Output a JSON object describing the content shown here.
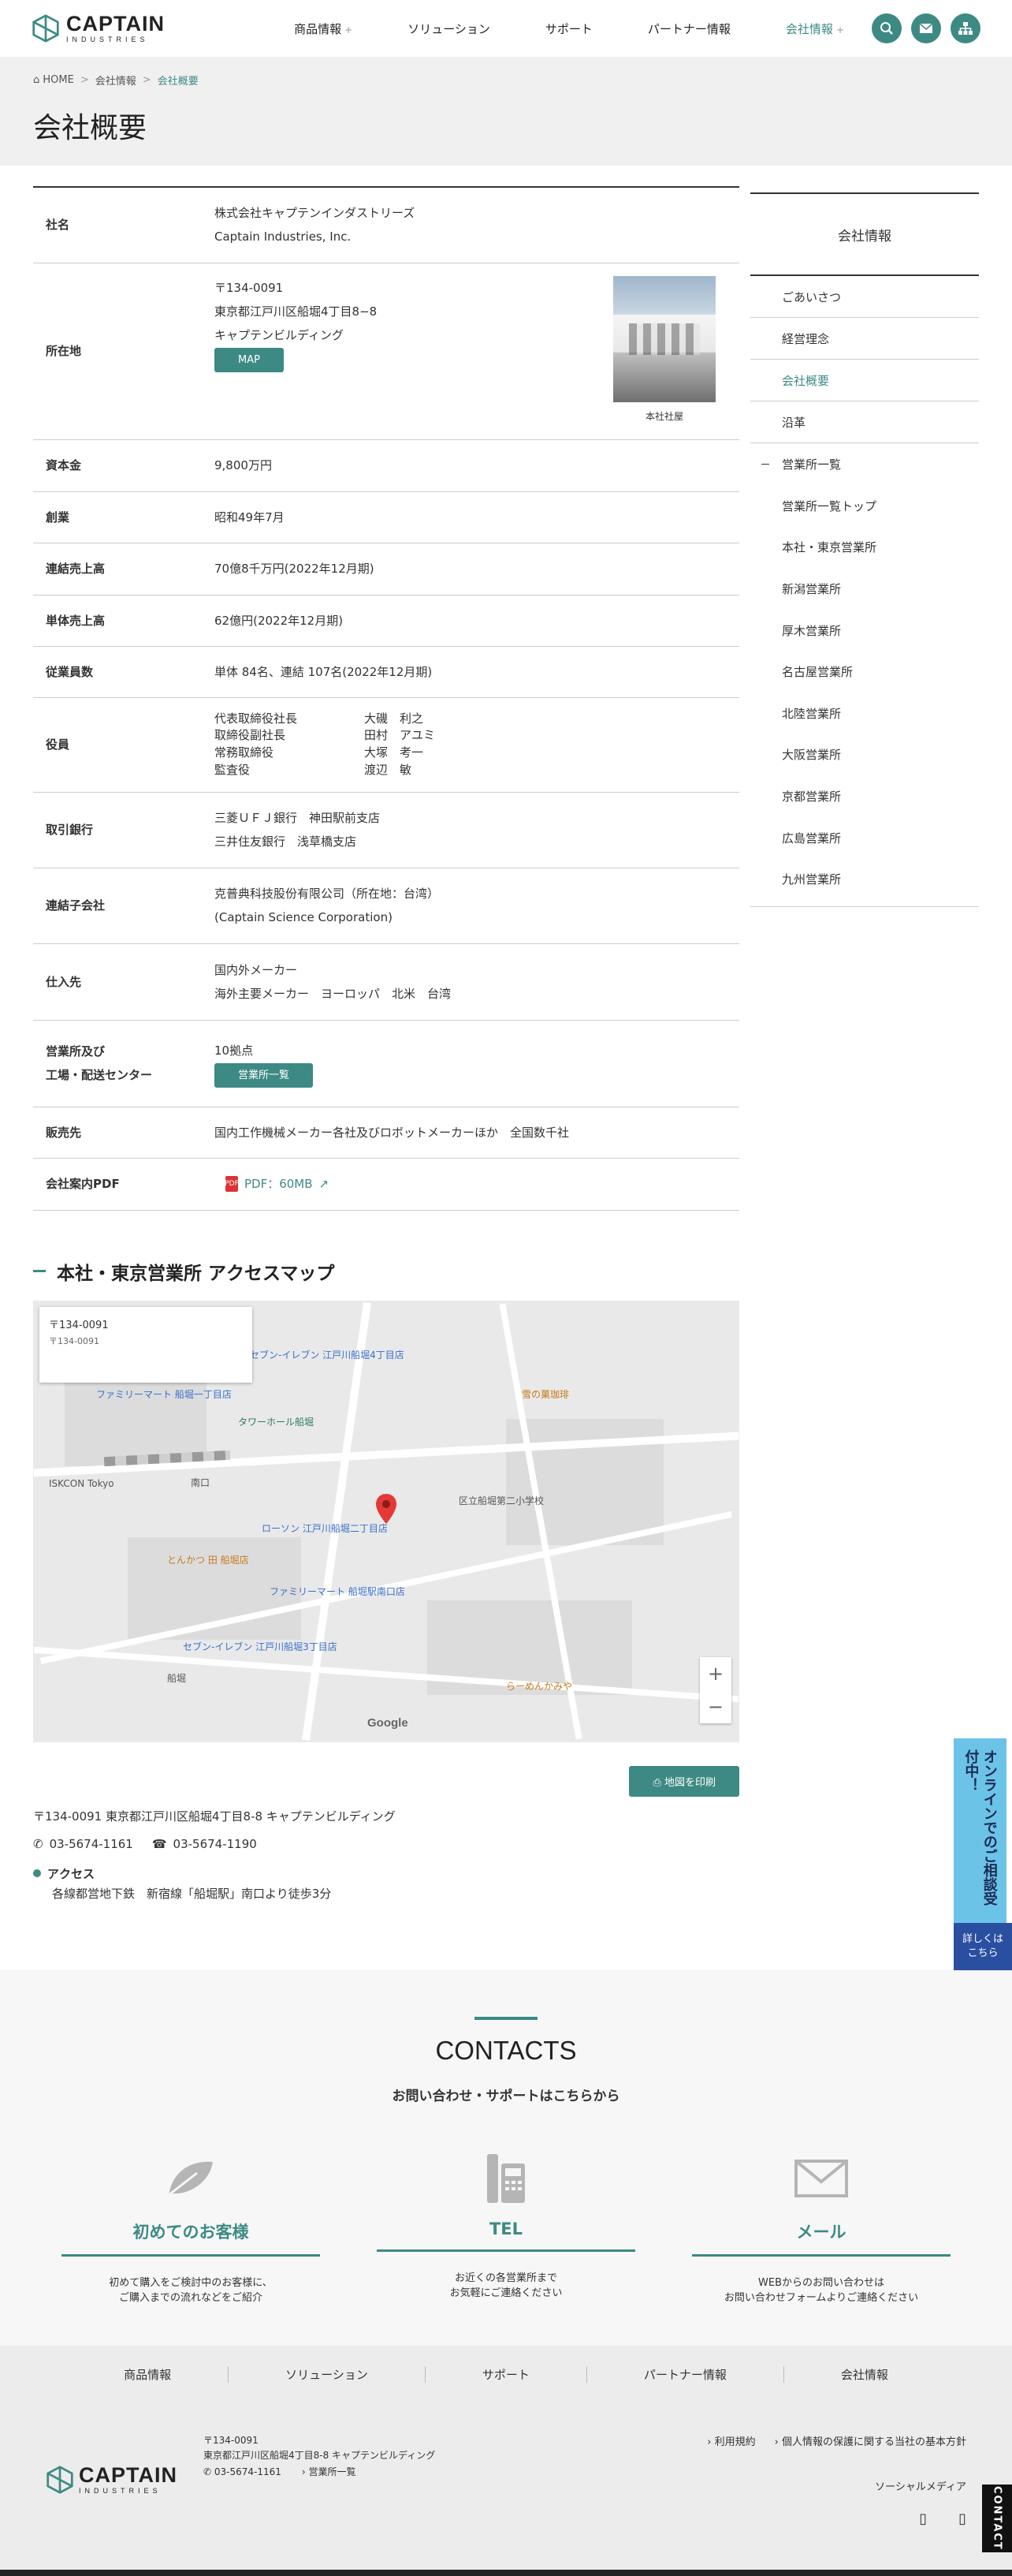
{
  "header": {
    "logo_main": "CAPTAIN",
    "logo_sub": "INDUSTRIES",
    "nav": [
      {
        "label": "商品情報",
        "plus": "+"
      },
      {
        "label": "ソリューション",
        "plus": ""
      },
      {
        "label": "サポート",
        "plus": ""
      },
      {
        "label": "パートナー情報",
        "plus": ""
      },
      {
        "label": "会社情報",
        "plus": "+"
      }
    ]
  },
  "breadcrumb": {
    "home": "HOME",
    "parent": "会社情報",
    "current": "会社概要",
    "sep": ">"
  },
  "page_title": "会社概要",
  "table": {
    "name_label": "社名",
    "name_values": [
      "株式会社キャプテンインダストリーズ",
      "Captain Industries, Inc."
    ],
    "address_label": "所在地",
    "address_values": [
      "〒134-0091",
      "東京都江戸川区船堀4丁目8−8",
      "キャプテンビルディング"
    ],
    "map_button": "MAP",
    "building_caption": "本社社屋",
    "capital_label": "資本金",
    "capital_value": "9,800万円",
    "founded_label": "創業",
    "founded_value": "昭和49年7月",
    "consolidated_label": "連結売上高",
    "consolidated_value": "70億8千万円(2022年12月期)",
    "standalone_label": "単体売上高",
    "standalone_value": "62億円(2022年12月期)",
    "employees_label": "従業員数",
    "employees_value": "単体 84名、連結 107名(2022年12月期)",
    "officers_label": "役員",
    "officers": [
      {
        "title": "代表取締役社長",
        "name": "大磯　利之"
      },
      {
        "title": "取締役副社長",
        "name": "田村　アユミ"
      },
      {
        "title": "常務取締役",
        "name": "大塚　考一"
      },
      {
        "title": "監査役",
        "name": "渡辺　敏"
      }
    ],
    "banks_label": "取引銀行",
    "banks_values": [
      "三菱ＵＦＪ銀行　神田駅前支店",
      "三井住友銀行　浅草橋支店"
    ],
    "subsidiary_label": "連結子会社",
    "subsidiary_values": [
      "克普典科技股份有限公司（所在地：台湾）",
      "(Captain Science Corporation)"
    ],
    "suppliers_label": "仕入先",
    "suppliers_values": [
      "国内外メーカー",
      "海外主要メーカー　ヨーロッパ　北米　台湾"
    ],
    "offices_label_1": "営業所及び",
    "offices_label_2": "工場・配送センター",
    "offices_value": "10拠点",
    "offices_button": "営業所一覧",
    "sales_label": "販売先",
    "sales_value": "国内工作機械メーカー各社及びロボットメーカーほか　全国数千社",
    "pdf_label": "会社案内PDF",
    "pdf_icon_text": "PDF",
    "pdf_link": "PDF：60MB"
  },
  "map_section": {
    "title": "本社・東京営業所 アクセスマップ",
    "card_title": "〒134-0091",
    "map_labels": [
      "ファミリーマート 船堀一丁目店",
      "セブン-イレブン 江戸川船堀4丁目店",
      "タワーホール船堀",
      "ISKCON Tokyo",
      "南口",
      "ローソン 江戸川船堀二丁目店",
      "とんかつ 田 船堀店",
      "ファミリーマート 船堀駅南口店",
      "セブン-イレブン 江戸川船堀3丁目店",
      "雪の菓珈琲",
      "らーめんかみや",
      "区立船堀第二小学校",
      "船堀",
      "Google"
    ],
    "print_button": "地図を印刷",
    "address": "〒134-0091 東京都江戸川区船堀4丁目8-8 キャプテンビルディング",
    "tel": "03-5674-1161",
    "fax": "03-5674-1190",
    "access_head": "アクセス",
    "access_body": "各線都営地下鉄　新宿線「船堀駅」南口より徒歩3分"
  },
  "sidebar": {
    "head": "会社情報",
    "items": [
      "ごあいさつ",
      "経営理念",
      "会社概要",
      "沿革"
    ],
    "group_head": "営業所一覧",
    "group_items": [
      "営業所一覧トップ",
      "本社・東京営業所",
      "新潟営業所",
      "厚木営業所",
      "名古屋営業所",
      "北陸営業所",
      "大阪営業所",
      "京都営業所",
      "広島営業所",
      "九州営業所"
    ]
  },
  "float_tab": {
    "top": "オンラインでのご相談受付中！",
    "bottom_1": "詳しくは",
    "bottom_2": "こちら"
  },
  "contacts": {
    "title": "CONTACTS",
    "lead": "お問い合わせ・サポートはこちらから",
    "cards": [
      {
        "title": "初めてのお客様",
        "desc": "初めて購入をご検討中のお客様に、\nご購入までの流れなどをご紹介"
      },
      {
        "title": "TEL",
        "desc": "お近くの各営業所まで\nお気軽にご連絡ください"
      },
      {
        "title": "メール",
        "desc": "WEBからのお問い合わせは\nお問い合わせフォームよりご連絡ください"
      }
    ]
  },
  "footer": {
    "nav": [
      "商品情報",
      "ソリューション",
      "サポート",
      "パートナー情報",
      "会社情報"
    ],
    "zip": "〒134-0091",
    "address": "東京都江戸川区船堀4丁目8-8 キャプテンビルディング",
    "tel": "03-5674-1161",
    "offices_link": "営業所一覧",
    "links": [
      "利用規約",
      "個人情報の保護に関する当社の基本方針"
    ],
    "social": "ソーシャルメディア"
  },
  "contact_side": "CONTACT",
  "colors": {
    "accent": "#3d8a84",
    "float_top": "#6cc3e8",
    "float_bottom": "#2a4fa1"
  }
}
